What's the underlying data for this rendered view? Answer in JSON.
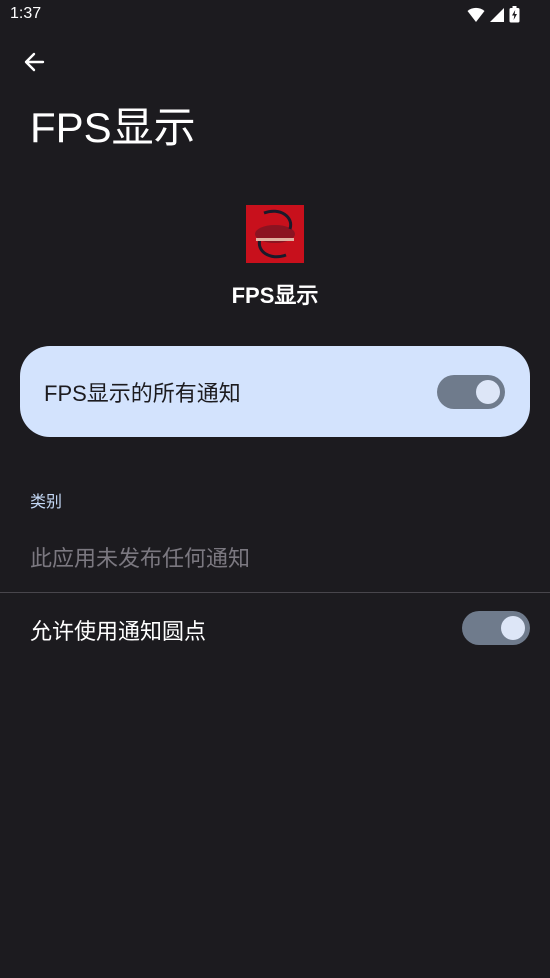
{
  "status_bar": {
    "time": "1:37",
    "icons": [
      "wifi-icon",
      "cellular-signal-icon",
      "battery-charging-icon"
    ]
  },
  "header": {
    "back_icon": "arrow-left-icon",
    "title": "FPS显示"
  },
  "app": {
    "name": "FPS显示",
    "icon_text": "FPS显示",
    "icon_color": "#c8101c"
  },
  "master_toggle": {
    "label": "FPS显示的所有通知",
    "checked": true
  },
  "categories": {
    "header": "类别",
    "empty_message": "此应用未发布任何通知"
  },
  "notification_dot": {
    "label": "允许使用通知圆点",
    "checked": true
  },
  "colors": {
    "background": "#1c1b1f",
    "card": "#d3e3fd",
    "toggle_track": "#6f7b8c",
    "toggle_thumb": "#dde6f7",
    "accent_text": "#c4d8f5"
  }
}
